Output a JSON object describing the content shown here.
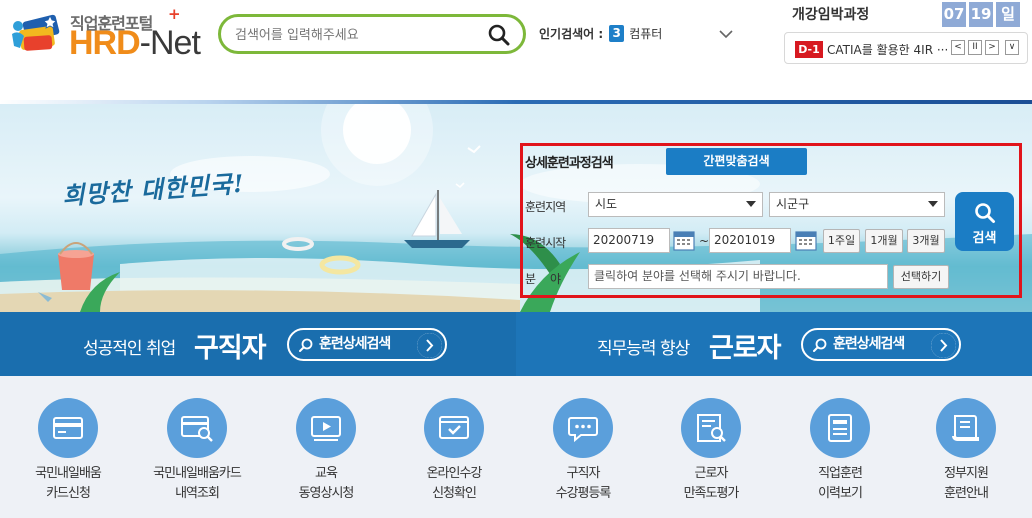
{
  "header": {
    "logo_small": "직업훈련포털",
    "logo_plus": "+",
    "logo_brand_a": "HRD",
    "logo_brand_b": "-Net",
    "search_placeholder": "검색어를 입력해주세요",
    "popular_label": "인기검색어 :",
    "popular_rank": "3",
    "popular_keyword": "컴퓨터"
  },
  "deadline": {
    "title": "개강임박과정",
    "month": "07",
    "day": "19",
    "weekday": "일",
    "badge": "D-1",
    "course": "CATIA를 활용한 4IR ···",
    "controls": [
      "<",
      "II",
      ">",
      "∨"
    ]
  },
  "hero": {
    "slogan": "희망찬 대한민국!"
  },
  "detail_search": {
    "title": "상세훈련과정검색",
    "easy_button": "간편맞춤검색",
    "region_label": "훈련지역",
    "region_province": "시도",
    "region_city": "시군구",
    "start_label": "훈련시작",
    "date_from": "20200719",
    "date_sep": "~",
    "date_to": "20201019",
    "period_buttons": [
      "1주일",
      "1개월",
      "3개월"
    ],
    "field_label_a": "분",
    "field_label_b": "야",
    "field_placeholder": "클릭하여 분야를 선택해 주시기 바랍니다.",
    "select_button": "선택하기",
    "search_button": "검색"
  },
  "band": {
    "left_sub": "성공적인 취업",
    "left_main": "구직자",
    "left_button": "훈련상세검색",
    "right_sub": "직무능력 향상",
    "right_main": "근로자",
    "right_button": "훈련상세검색"
  },
  "quick_menu": [
    {
      "line1": "국민내일배움",
      "line2": "카드신청",
      "icon": "card-icon"
    },
    {
      "line1": "국민내일배움카드",
      "line2": "내역조회",
      "icon": "card-search-icon"
    },
    {
      "line1": "교육",
      "line2": "동영상시청",
      "icon": "video-icon"
    },
    {
      "line1": "온라인수강",
      "line2": "신청확인",
      "icon": "online-check-icon"
    },
    {
      "line1": "구직자",
      "line2": "수강평등록",
      "icon": "chat-icon"
    },
    {
      "line1": "근로자",
      "line2": "만족도평가",
      "icon": "survey-icon"
    },
    {
      "line1": "직업훈련",
      "line2": "이력보기",
      "icon": "history-icon"
    },
    {
      "line1": "정부지원",
      "line2": "훈련안내",
      "icon": "book-icon"
    }
  ],
  "colors": {
    "brand_orange": "#f08c1a",
    "search_border": "#7db83a",
    "primary_blue": "#1b7dc5",
    "highlight_red": "#e1141b",
    "quick_circle": "#5b9fdb"
  }
}
